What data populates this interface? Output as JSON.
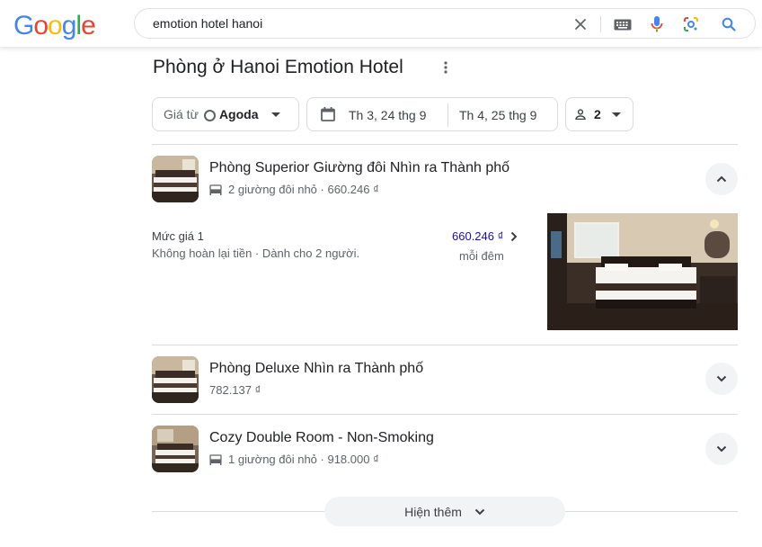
{
  "logo": {
    "text": "Google"
  },
  "search": {
    "query": "emotion hotel hanoi"
  },
  "icons": {
    "clear": "close-icon",
    "keyboard": "keyboard-icon",
    "voice": "microphone-icon",
    "lens": "lens-icon",
    "search": "search-icon"
  },
  "colors": {
    "google_blue": "#4285f4",
    "google_red": "#ea4335",
    "google_yellow": "#fbbc05",
    "google_green": "#34a853",
    "price_link": "#1a0dab"
  },
  "page": {
    "title": "Phòng ở Hanoi Emotion Hotel"
  },
  "filters": {
    "price_prefix": "Giá từ",
    "provider": "Agoda",
    "checkin": "Th 3, 24 thg 9",
    "checkout": "Th 4, 25 thg 9",
    "guests": "2"
  },
  "rooms": [
    {
      "name": "Phòng Superior Giường đôi Nhìn ra Thành phố",
      "subtitle": "2 giường đôi nhỏ · 660.246 ₫",
      "expanded": true,
      "rate": {
        "label": "Mức giá 1",
        "details": "Không hoàn lại tiền · Dành cho 2 người.",
        "price": "660.246 ₫",
        "per": "mỗi đêm"
      }
    },
    {
      "name": "Phòng Deluxe Nhìn ra Thành phố",
      "subtitle": "782.137 ₫",
      "expanded": false
    },
    {
      "name": "Cozy Double Room - Non-Smoking",
      "subtitle": "1 giường đôi nhỏ · 918.000 ₫",
      "expanded": false
    }
  ],
  "show_more": {
    "label": "Hiện thêm"
  }
}
